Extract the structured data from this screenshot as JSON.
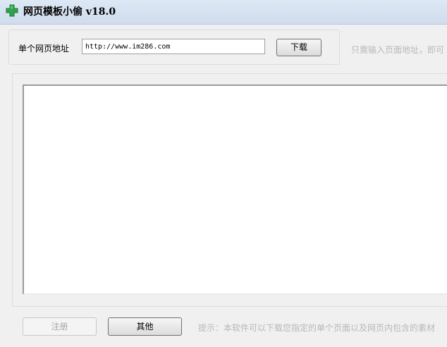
{
  "window": {
    "title": "网页模板小偷 v18.0",
    "icon": "green-cross-icon"
  },
  "url_section": {
    "label": "单个网页地址",
    "url_value": "http://www.im286.com",
    "download_label": "下载",
    "hint": "只需输入页面地址，即可"
  },
  "content_area": {
    "text": ""
  },
  "footer": {
    "register_label": "注册",
    "register_enabled": false,
    "other_label": "其他",
    "hint": "提示：本软件可以下载您指定的单个页面以及网页内包含的素材"
  },
  "colors": {
    "icon_green": "#2ea44a",
    "disabled_text": "#a6a6a6",
    "hint_text": "#b8b8b8"
  }
}
